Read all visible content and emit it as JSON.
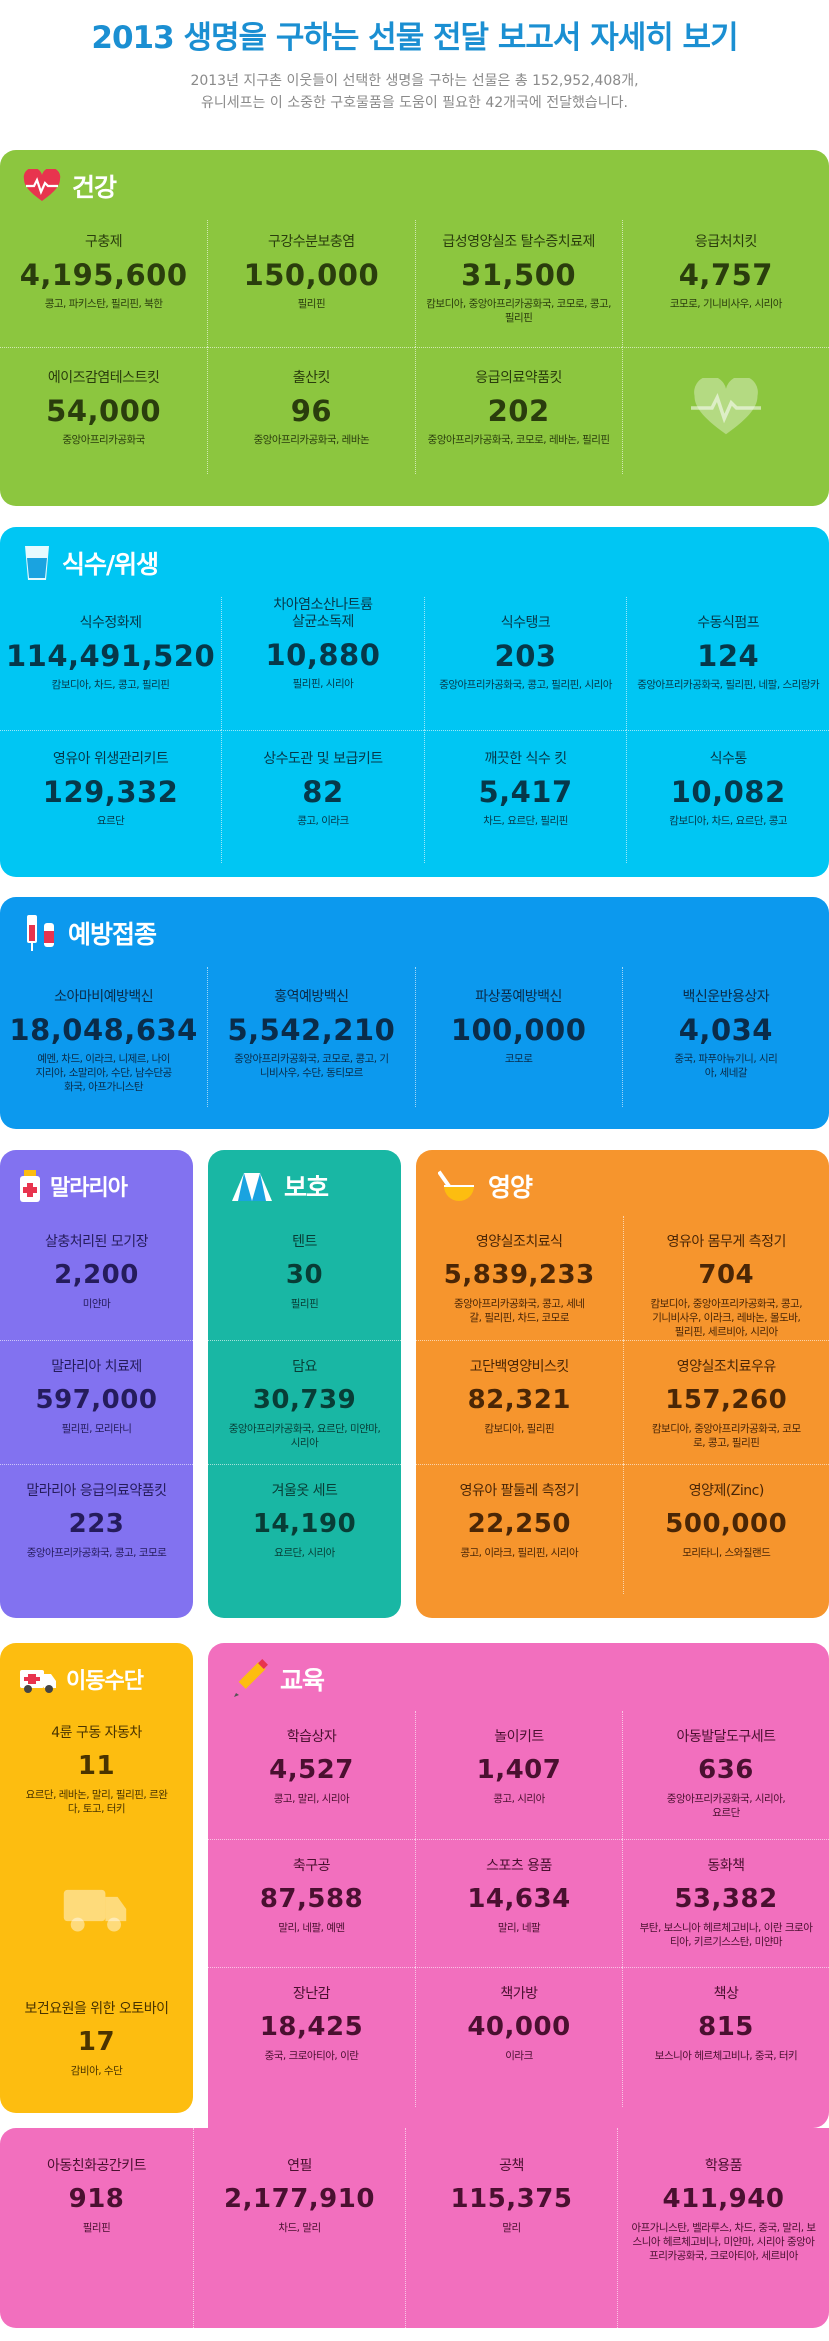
{
  "header": {
    "title": "2013 생명을 구하는 선물 전달 보고서 자세히 보기",
    "subtitle_line1": "2013년 지구촌 이웃들이 선택한 생명을 구하는 선물은 총 152,952,408개,",
    "subtitle_line2": "유니세프는 이 소중한 구호물품을 도움이 필요한 42개국에 전달했습니다."
  },
  "colors": {
    "title": "#1b8fd2",
    "health": "#8cc63f",
    "water": "#00c6f3",
    "vaccine": "#0c99ee",
    "malaria": "#8272f0",
    "protection": "#19b7a4",
    "nutrition": "#f6952d",
    "transport": "#fdbd10",
    "education": "#f26fbe"
  },
  "health": {
    "name": "건강",
    "icon": "heartbeat-icon",
    "items": [
      {
        "label": "구충제",
        "value": "4,195,600",
        "loc": "콩고, 파키스탄, 필리핀, 북한"
      },
      {
        "label": "구강수분보충염",
        "value": "150,000",
        "loc": "필리핀"
      },
      {
        "label": "급성영양실조 탈수증치료제",
        "value": "31,500",
        "loc": "캄보디아, 중앙아프리카공화국, 코모로, 콩고, 필리핀"
      },
      {
        "label": "응급처치킷",
        "value": "4,757",
        "loc": "코모로, 기니비사우, 시리아"
      },
      {
        "label": "에이즈감염테스트킷",
        "value": "54,000",
        "loc": "중앙아프리카공화국"
      },
      {
        "label": "출산킷",
        "value": "96",
        "loc": "중앙아프리카공화국, 레바논"
      },
      {
        "label": "응급의료약품킷",
        "value": "202",
        "loc": "중앙아프리카공화국, 코모로, 레바논, 필리핀"
      }
    ]
  },
  "water": {
    "name": "식수/위생",
    "icon": "water-glass-icon",
    "items": [
      {
        "label": "식수정화제",
        "value": "114,491,520",
        "loc": "캄보디아, 차드, 콩고, 필리핀"
      },
      {
        "label": "차아염소산나트륨 살균소독제",
        "value": "10,880",
        "loc": "필리핀, 시리아"
      },
      {
        "label": "식수탱크",
        "value": "203",
        "loc": "중앙아프리카공화국, 콩고, 필리핀, 시리아"
      },
      {
        "label": "수동식펌프",
        "value": "124",
        "loc": "중앙아프리카공화국, 필리핀, 네팔, 스리랑카"
      },
      {
        "label": "영유아 위생관리키트",
        "value": "129,332",
        "loc": "요르단"
      },
      {
        "label": "상수도관 및 보급키트",
        "value": "82",
        "loc": "콩고, 이라크"
      },
      {
        "label": "깨끗한 식수 킷",
        "value": "5,417",
        "loc": "차드, 요르단, 필리핀"
      },
      {
        "label": "식수통",
        "value": "10,082",
        "loc": "캄보디아, 차드, 요르단, 콩고"
      }
    ]
  },
  "vaccine": {
    "name": "예방접종",
    "icon": "syringe-icon",
    "items": [
      {
        "label": "소아마비예방백신",
        "value": "18,048,634",
        "loc": "예멘, 차드, 이라크, 니제르, 나이지리아, 소말리아, 수단, 남수단공화국, 아프가니스탄"
      },
      {
        "label": "홍역예방백신",
        "value": "5,542,210",
        "loc": "중앙아프리카공화국, 코모로, 콩고, 기니비사우, 수단, 동티모르"
      },
      {
        "label": "파상풍예방백신",
        "value": "100,000",
        "loc": "코모로"
      },
      {
        "label": "백신운반용상자",
        "value": "4,034",
        "loc": "중국, 파푸아뉴기니, 시리아, 세네갈"
      }
    ]
  },
  "malaria": {
    "name": "말라리아",
    "icon": "medicine-bottle-icon",
    "items": [
      {
        "label": "살충처리된 모기장",
        "value": "2,200",
        "loc": "미얀마"
      },
      {
        "label": "말라리아 치료제",
        "value": "597,000",
        "loc": "필리핀, 모리타니"
      },
      {
        "label": "말라리아 응급의료약품킷",
        "value": "223",
        "loc": "중앙아프리카공화국, 콩고, 코모로"
      }
    ]
  },
  "protection": {
    "name": "보호",
    "icon": "tent-icon",
    "items": [
      {
        "label": "텐트",
        "value": "30",
        "loc": "필리핀"
      },
      {
        "label": "담요",
        "value": "30,739",
        "loc": "중앙아프리카공화국, 요르단, 미얀마, 시리아"
      },
      {
        "label": "겨울옷 세트",
        "value": "14,190",
        "loc": "요르단, 시리아"
      }
    ]
  },
  "nutrition": {
    "name": "영양",
    "icon": "bowl-spoon-icon",
    "items": [
      {
        "label": "영양실조치료식",
        "value": "5,839,233",
        "loc": "중앙아프리카공화국, 콩고, 세네갈, 필리핀, 차드, 코모로"
      },
      {
        "label": "영유아 몸무게 측정기",
        "value": "704",
        "loc": "캄보디아, 중앙아프리카공화국, 콩고, 기니비사우, 이라크, 레바논, 몰도바, 필리핀, 세르비아, 시리아"
      },
      {
        "label": "고단백영양비스킷",
        "value": "82,321",
        "loc": "캄보디아, 필리핀"
      },
      {
        "label": "영양실조치료우유",
        "value": "157,260",
        "loc": "캄보디아, 중앙아프리카공화국, 코모로, 콩고, 필리핀"
      },
      {
        "label": "영유아 팔둘레 측정기",
        "value": "22,250",
        "loc": "콩고, 이라크, 필리핀, 시리아"
      },
      {
        "label": "영양제(Zinc)",
        "value": "500,000",
        "loc": "모리타니, 스와질랜드"
      }
    ]
  },
  "transport": {
    "name": "이동수단",
    "icon": "ambulance-icon",
    "items": [
      {
        "label": "4륜 구동 자동차",
        "value": "11",
        "loc": "요르단, 레바논, 말리, 필리핀, 르완다, 토고, 터키"
      },
      {
        "label": "보건요원을 위한 오토바이",
        "value": "17",
        "loc": "감비아, 수단"
      }
    ]
  },
  "education": {
    "name": "교육",
    "icon": "pencil-icon",
    "items": [
      {
        "label": "학습상자",
        "value": "4,527",
        "loc": "콩고, 말리, 시리아"
      },
      {
        "label": "놀이키트",
        "value": "1,407",
        "loc": "콩고, 시리아"
      },
      {
        "label": "아동발달도구세트",
        "value": "636",
        "loc": "중앙아프리카공화국, 시리아, 요르단"
      },
      {
        "label": "축구공",
        "value": "87,588",
        "loc": "말리, 네팔, 예멘"
      },
      {
        "label": "스포츠 용품",
        "value": "14,634",
        "loc": "말리, 네팔"
      },
      {
        "label": "동화책",
        "value": "53,382",
        "loc": "부탄, 보스니아 헤르체고비나, 이란 크로아티아, 키르기스스탄, 미얀마"
      },
      {
        "label": "장난감",
        "value": "18,425",
        "loc": "중국, 크로아티아, 이란"
      },
      {
        "label": "책가방",
        "value": "40,000",
        "loc": "이라크"
      },
      {
        "label": "책상",
        "value": "815",
        "loc": "보스니아 헤르체고비나, 중국, 터키"
      },
      {
        "label": "아동친화공간키트",
        "value": "918",
        "loc": "필리핀"
      },
      {
        "label": "연필",
        "value": "2,177,910",
        "loc": "차드, 말리"
      },
      {
        "label": "공책",
        "value": "115,375",
        "loc": "말리"
      },
      {
        "label": "학용품",
        "value": "411,940",
        "loc": "아프가니스탄, 벨라루스, 차드, 중국, 말리, 보스니아 헤르체고비나, 미얀마, 시리아 중앙아프리카공화국, 크로아티아, 세르비아"
      }
    ]
  }
}
